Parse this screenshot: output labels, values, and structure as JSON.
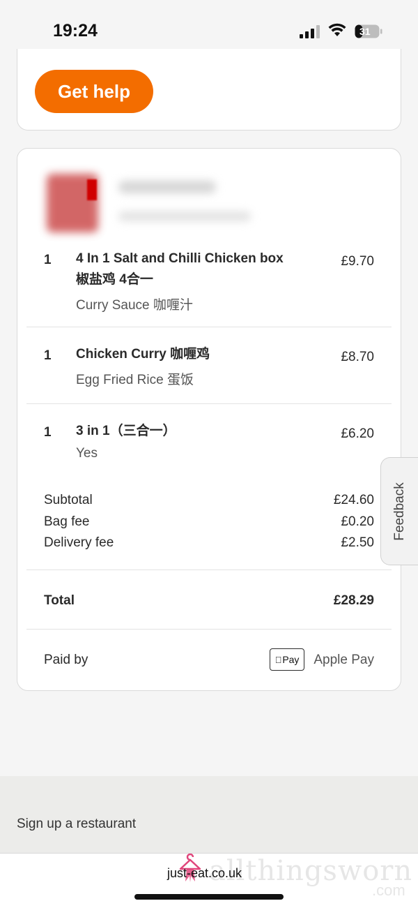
{
  "status_bar": {
    "time": "19:24",
    "battery": "31"
  },
  "help": {
    "button_label": "Get help"
  },
  "order": {
    "items": [
      {
        "qty": "1",
        "name_line1": "4 In 1 Salt and Chilli Chicken box",
        "name_line2": "椒盐鸡 4合一",
        "option": "Curry Sauce 咖喱汁",
        "price": "£9.70"
      },
      {
        "qty": "1",
        "name_line1": "Chicken Curry 咖喱鸡",
        "option": "Egg Fried Rice 蛋饭",
        "price": "£8.70"
      },
      {
        "qty": "1",
        "name_line1": "3 in 1（三合一）",
        "option": "Yes",
        "price": "£6.20"
      }
    ],
    "subtotal_label": "Subtotal",
    "subtotal_value": "£24.60",
    "bag_fee_label": "Bag fee",
    "bag_fee_value": "£0.20",
    "delivery_fee_label": "Delivery fee",
    "delivery_fee_value": "£2.50",
    "total_label": "Total",
    "total_value": "£28.29",
    "paid_by_label": "Paid by",
    "payment_badge": "Pay",
    "payment_method": "Apple Pay"
  },
  "feedback": {
    "label": "Feedback"
  },
  "footer": {
    "signup_link": "Sign up a restaurant"
  },
  "bottom": {
    "domain": "just-eat.co.uk",
    "watermark": "allthingsworn",
    "watermark_sub": ".com"
  },
  "colors": {
    "accent": "#f36d00",
    "watermark_pink": "#e0457b"
  }
}
